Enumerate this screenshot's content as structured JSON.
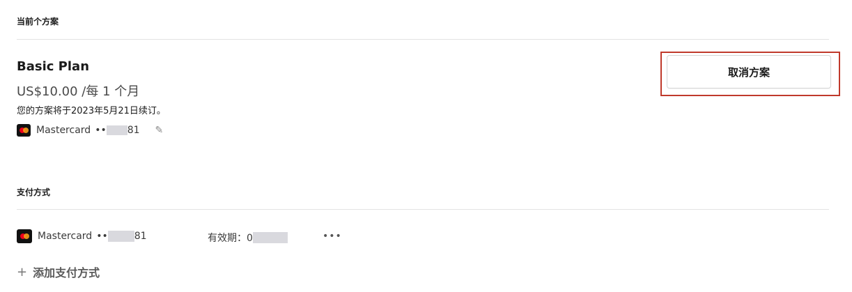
{
  "current_plan": {
    "section_title": "当前个方案",
    "plan_name": "Basic Plan",
    "price": "US$10.00 /每 1 个月",
    "renewal_text": "您的方案将于2023年5月21日续订。",
    "card_brand": "Mastercard",
    "card_dots": "••",
    "card_last_digits": "81",
    "cancel_button": "取消方案"
  },
  "payment_methods": {
    "section_title": "支付方式",
    "card_brand": "Mastercard",
    "card_dots": "••",
    "card_last_digits": "81",
    "expiry_label": "有效期：0",
    "more_label": "•••",
    "add_label": "添加支付方式",
    "add_icon": "+"
  },
  "colors": {
    "highlight": "#c0392b",
    "mastercard_red": "#eb001b",
    "mastercard_orange": "#f79e1b"
  }
}
